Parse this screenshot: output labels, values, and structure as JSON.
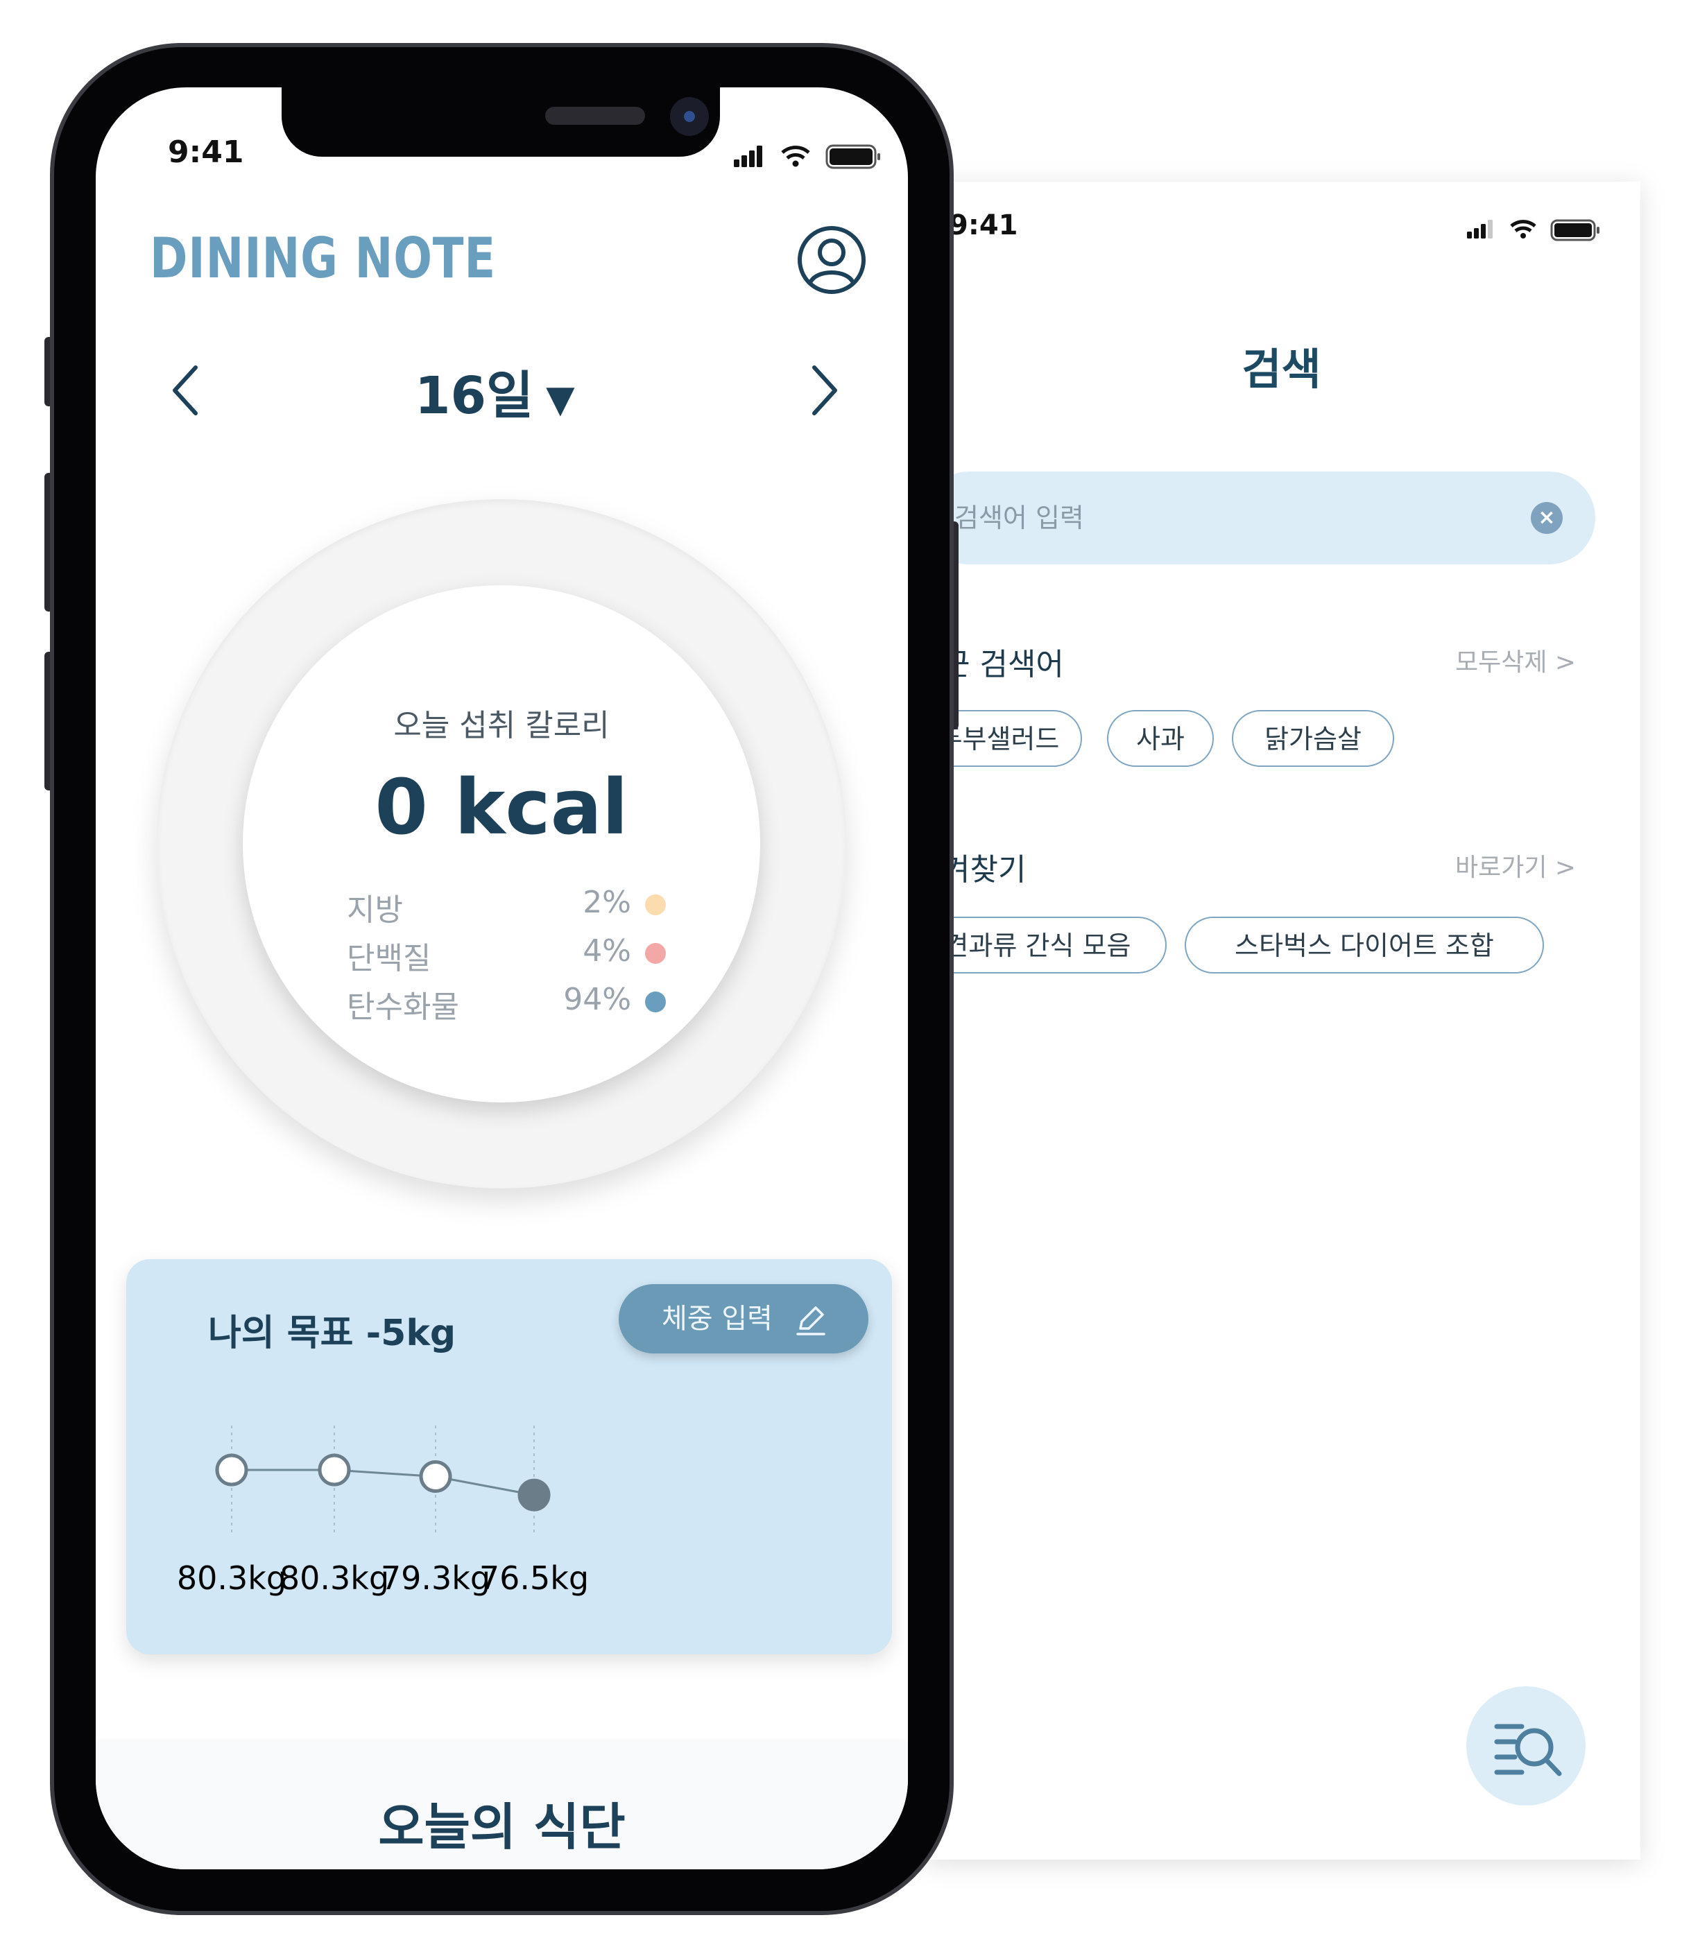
{
  "search_screen": {
    "status_time": "9:41",
    "title": "검색",
    "search_placeholder": "검색어 입력",
    "recent": {
      "label": "근 검색어",
      "action": "모두삭제 >",
      "chips": [
        "두부샐러드",
        "사과",
        "닭가슴살"
      ]
    },
    "favorites": {
      "label": "겨찾기",
      "action": "바로가기 >",
      "chips": [
        "견과류 간식 모음",
        "스타벅스 다이어트 조합"
      ]
    },
    "fab_icon": "search-list-icon"
  },
  "phone": {
    "status_time": "9:41",
    "brand": "DINING NOTE",
    "profile_icon": "profile-icon",
    "date": "16일",
    "calorie": {
      "label": "오늘 섭취 칼로리",
      "value": "0 kcal",
      "macros": [
        {
          "name": "지방",
          "pct": "2%",
          "color": "#fbdcaf"
        },
        {
          "name": "단백질",
          "pct": "4%",
          "color": "#f4a7a7"
        },
        {
          "name": "탄수화물",
          "pct": "94%",
          "color": "#6a9ebe"
        }
      ]
    },
    "goal": {
      "title": "나의 목표  -5kg",
      "button": "체중 입력",
      "weights": [
        80.3,
        80.3,
        79.3,
        76.5
      ],
      "weight_labels": [
        "80.3kg",
        "80.3kg",
        "79.3kg",
        "76.5kg"
      ]
    },
    "bottom_title": "오늘의 식단"
  },
  "colors": {
    "primary": "#1d4159",
    "accent": "#6a9ebe",
    "card_bg": "#d1e7f6",
    "search_bg": "#dcedf8"
  }
}
